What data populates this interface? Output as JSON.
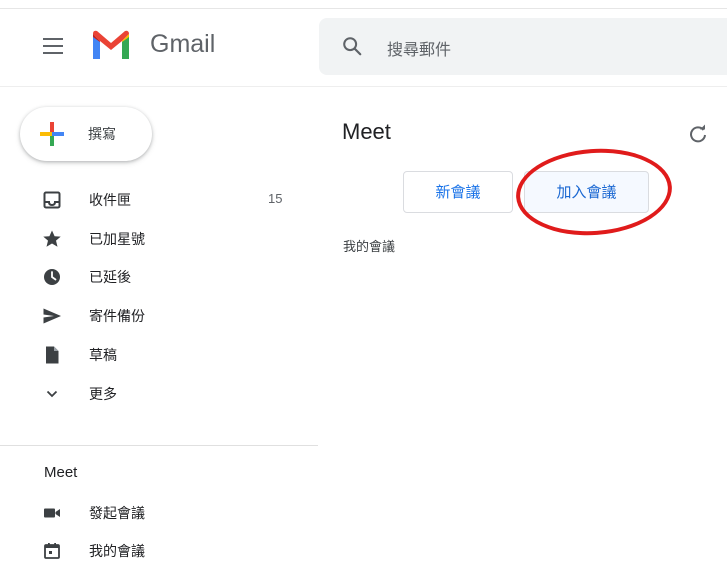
{
  "header": {
    "brand": "Gmail",
    "search_placeholder": "搜尋郵件"
  },
  "sidebar": {
    "compose_label": "撰寫",
    "items": [
      {
        "label": "收件匣",
        "icon": "inbox-icon",
        "count": "15"
      },
      {
        "label": "已加星號",
        "icon": "star-icon"
      },
      {
        "label": "已延後",
        "icon": "clock-icon"
      },
      {
        "label": "寄件備份",
        "icon": "send-icon"
      },
      {
        "label": "草稿",
        "icon": "draft-icon"
      },
      {
        "label": "更多",
        "icon": "chevron-down-icon"
      }
    ],
    "meet": {
      "title": "Meet",
      "items": [
        {
          "label": "發起會議",
          "icon": "video-icon"
        },
        {
          "label": "我的會議",
          "icon": "calendar-icon"
        }
      ]
    }
  },
  "main": {
    "title": "Meet",
    "new_meeting_label": "新會議",
    "join_meeting_label": "加入會議",
    "my_meetings_label": "我的會議"
  },
  "colors": {
    "accent_blue": "#1a73e8",
    "highlight_red": "#e01b1b",
    "icon_gray": "#5f6368"
  }
}
